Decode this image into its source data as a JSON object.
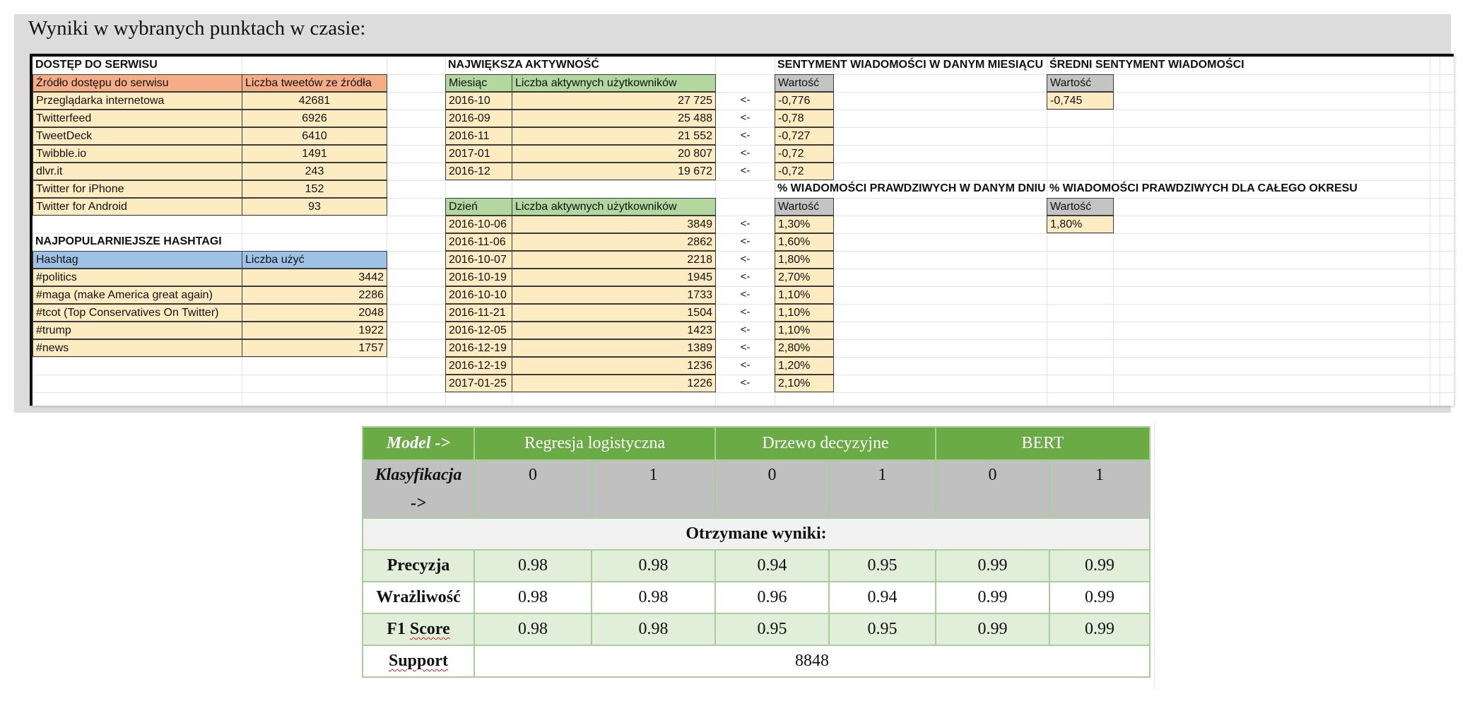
{
  "header": {
    "title": "Wyniki w wybranych punktach w czasie:"
  },
  "sheet": {
    "access": {
      "section_title": "DOSTĘP DO SERWISU",
      "col1": "Źródło dostępu do serwisu",
      "col2": "Liczba tweetów ze źródła",
      "rows": [
        {
          "source": "Przeglądarka internetowa",
          "count": "42681"
        },
        {
          "source": "Twitterfeed",
          "count": "6926"
        },
        {
          "source": "TweetDeck",
          "count": "6410"
        },
        {
          "source": "Twibble.io",
          "count": "1491"
        },
        {
          "source": "dlvr.it",
          "count": "243"
        },
        {
          "source": "Twitter for iPhone",
          "count": "152"
        },
        {
          "source": "Twitter for Android",
          "count": "93"
        }
      ]
    },
    "hashtags": {
      "section_title": "NAJPOPULARNIEJSZE HASHTAGI",
      "col1": "Hashtag",
      "col2": "Liczba użyć",
      "rows": [
        {
          "tag": "#politics",
          "count": "3442"
        },
        {
          "tag": "#maga (make America great again)",
          "count": "2286"
        },
        {
          "tag": "#tcot (Top Conservatives On Twitter)",
          "count": "2048"
        },
        {
          "tag": "#trump",
          "count": "1922"
        },
        {
          "tag": "#news",
          "count": "1757"
        }
      ]
    },
    "activity": {
      "section_title": "NAJWIĘKSZA AKTYWNOŚĆ",
      "month_col": "Miesiąc",
      "users_col": "Liczba aktywnych użytkowników",
      "arrow": "<-",
      "months": [
        {
          "period": "2016-10",
          "users": "27 725"
        },
        {
          "period": "2016-09",
          "users": "25 488"
        },
        {
          "period": "2016-11",
          "users": "21 552"
        },
        {
          "period": "2017-01",
          "users": "20 807"
        },
        {
          "period": "2016-12",
          "users": "19 672"
        }
      ],
      "day_col": "Dzień",
      "days": [
        {
          "period": "2016-10-06",
          "users": "3849"
        },
        {
          "period": "2016-11-06",
          "users": "2862"
        },
        {
          "period": "2016-10-07",
          "users": "2218"
        },
        {
          "period": "2016-10-19",
          "users": "1945"
        },
        {
          "period": "2016-10-10",
          "users": "1733"
        },
        {
          "period": "2016-11-21",
          "users": "1504"
        },
        {
          "period": "2016-12-05",
          "users": "1423"
        },
        {
          "period": "2016-12-19",
          "users": "1389"
        },
        {
          "period": "2016-12-19",
          "users": "1236"
        },
        {
          "period": "2017-01-25",
          "users": "1226"
        }
      ]
    },
    "sentiment_month": {
      "section_title": "SENTYMENT WIADOMOŚCI W DANYM MIESIĄCU",
      "value_col": "Wartość",
      "values": [
        "-0,776",
        "-0,78",
        "-0,727",
        "-0,72",
        "-0,72"
      ]
    },
    "true_day": {
      "section_title": "% WIADOMOŚCI PRAWDZIWYCH W DANYM DNIU",
      "value_col": "Wartość",
      "values": [
        "1,30%",
        "1,60%",
        "1,80%",
        "2,70%",
        "1,10%",
        "1,10%",
        "1,10%",
        "2,80%",
        "1,20%",
        "2,10%"
      ]
    },
    "avg_sentiment": {
      "section_title": "ŚREDNI SENTYMENT WIADOMOŚCI",
      "value_col": "Wartość",
      "value": "-0,745"
    },
    "true_total": {
      "section_title": "% WIADOMOŚCI PRAWDZIWYCH DLA CAŁEGO OKRESU",
      "value_col": "Wartość",
      "value": "1,80%"
    }
  },
  "results": {
    "model_label": "Model ->",
    "models": [
      "Regresja logistyczna",
      "Drzewo decyzyjne",
      "BERT"
    ],
    "class_label_1": "Klasyfikacja",
    "class_label_2": "->",
    "classes": [
      "0",
      "1",
      "0",
      "1",
      "0",
      "1"
    ],
    "subheader": "Otrzymane wyniki:",
    "metrics": [
      {
        "name": "Precyzja",
        "values": [
          "0.98",
          "0.98",
          "0.94",
          "0.95",
          "0.99",
          "0.99"
        ]
      },
      {
        "name": "Wrażliwość",
        "values": [
          "0.98",
          "0.98",
          "0.96",
          "0.94",
          "0.99",
          "0.99"
        ]
      },
      {
        "name": "F1 ",
        "name_marked": "Score",
        "values": [
          "0.98",
          "0.98",
          "0.95",
          "0.95",
          "0.99",
          "0.99"
        ]
      }
    ],
    "support_label": "Support",
    "support_value": "8848"
  },
  "colors": {
    "orange_header": "#f5ad85",
    "green_header": "#b2d8a0",
    "gray_header": "#c4c4c4",
    "blue_header": "#9ec2e6",
    "yellow_cell": "#fdebc1",
    "table_green": "#6aab46",
    "table_light_green": "#e1efda"
  }
}
